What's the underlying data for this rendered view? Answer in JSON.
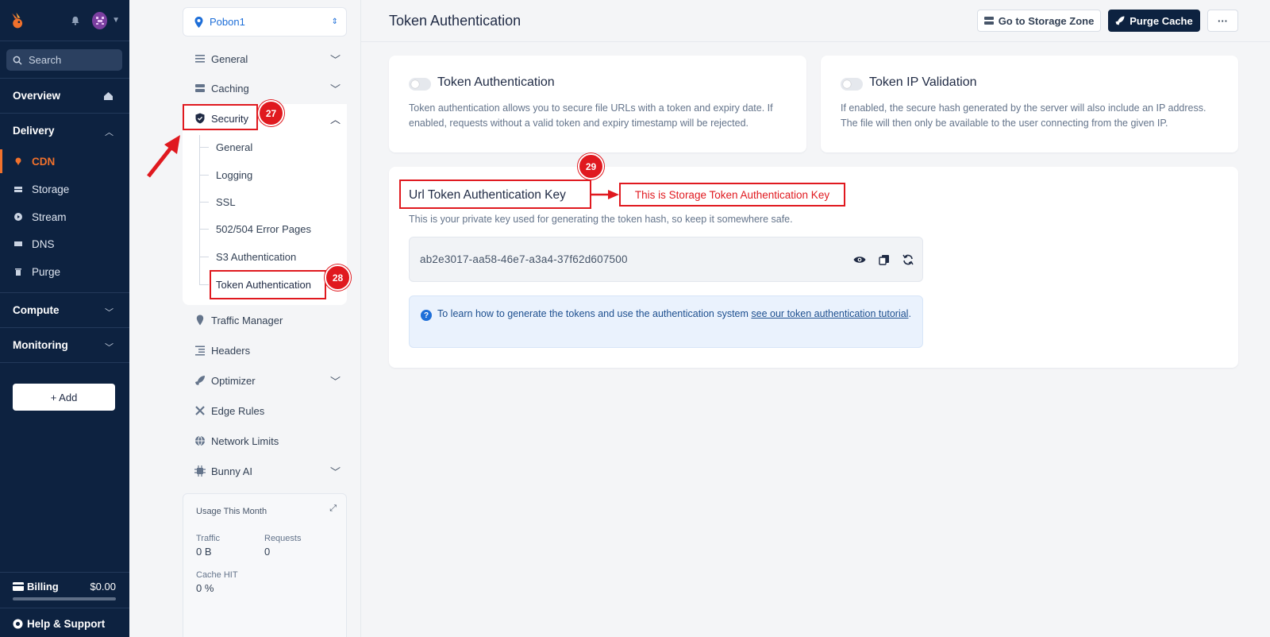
{
  "sidebar": {
    "search_placeholder": "Search",
    "overview": "Overview",
    "delivery": "Delivery",
    "items": [
      {
        "label": "CDN",
        "icon": "pin-icon"
      },
      {
        "label": "Storage",
        "icon": "storage-icon"
      },
      {
        "label": "Stream",
        "icon": "play-icon"
      },
      {
        "label": "DNS",
        "icon": "dns-icon"
      },
      {
        "label": "Purge",
        "icon": "trash-icon"
      }
    ],
    "compute": "Compute",
    "monitoring": "Monitoring",
    "add_label": "+ Add",
    "billing_label": "Billing",
    "billing_amount": "$0.00",
    "help_label": "Help & Support",
    "accent_color": "#f0712c"
  },
  "zone": {
    "name": "Pobon1",
    "nav": {
      "general": "General",
      "caching": "Caching",
      "security": "Security",
      "security_sub": [
        "General",
        "Logging",
        "SSL",
        "502/504 Error Pages",
        "S3 Authentication",
        "Token Authentication"
      ],
      "traffic_manager": "Traffic Manager",
      "headers": "Headers",
      "optimizer": "Optimizer",
      "edge_rules": "Edge Rules",
      "network_limits": "Network Limits",
      "bunny_ai": "Bunny AI"
    },
    "usage": {
      "title": "Usage This Month",
      "traffic_label": "Traffic",
      "traffic_value": "0 B",
      "requests_label": "Requests",
      "requests_value": "0",
      "cache_label": "Cache HIT",
      "cache_value": "0 %"
    }
  },
  "header": {
    "title": "Token Authentication",
    "go_storage": "Go to Storage Zone",
    "purge": "Purge Cache",
    "more": "···"
  },
  "cards": {
    "token_auth": {
      "title": "Token Authentication",
      "desc": "Token authentication allows you to secure file URLs with a token and expiry date. If enabled, requests without a valid token and expiry timestamp will be rejected."
    },
    "token_ip": {
      "title": "Token IP Validation",
      "desc": "If enabled, the secure hash generated by the server will also include an IP address. The file will then only be available to the user connecting from the given IP."
    },
    "url_key": {
      "title": "Url Token Authentication Key",
      "desc": "This is your private key used for generating the token hash, so keep it somewhere safe.",
      "key": "ab2e3017-aa58-46e7-a3a4-37f62d607500",
      "info_text": "To learn how to generate the tokens and use the authentication system ",
      "info_link": "see our token authentication tutorial",
      "info_end": "."
    }
  },
  "annotations": {
    "badge_27": "27",
    "badge_28": "28",
    "badge_29": "29",
    "note": "This is Storage Token Authentication Key",
    "color": "#e0191f"
  }
}
